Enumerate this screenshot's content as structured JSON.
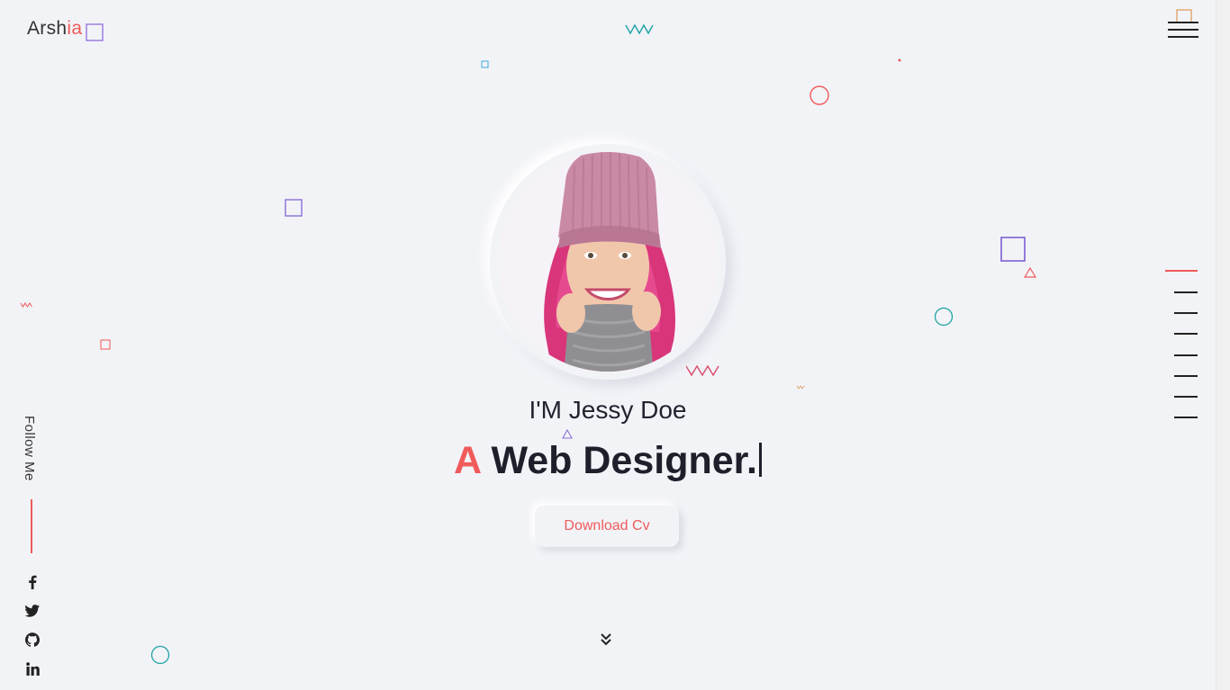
{
  "logo": {
    "main": "Arsh",
    "accent": "ia"
  },
  "hero": {
    "greeting": "I'M Jessy Doe",
    "role_accent": "A",
    "role_rest": "Web Designer.",
    "cta_label": "Download Cv"
  },
  "sidebar": {
    "follow_label": "Follow Me"
  },
  "social": [
    {
      "name": "facebook-icon"
    },
    {
      "name": "twitter-icon"
    },
    {
      "name": "github-icon"
    },
    {
      "name": "linkedin-icon"
    }
  ],
  "colors": {
    "accent": "#f05a5a",
    "background": "#f2f3f7",
    "text": "#1f1f2b",
    "purple": "#8a6fd6",
    "teal": "#1fa3a3",
    "orange": "#e0a060"
  }
}
